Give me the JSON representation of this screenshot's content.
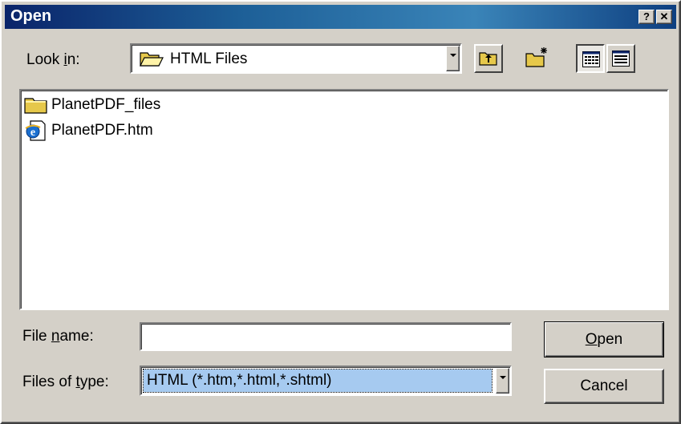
{
  "window": {
    "title": "Open",
    "help_glyph": "?",
    "close_glyph": "✕"
  },
  "look_in": {
    "label_pre": "Look ",
    "label_accel": "i",
    "label_post": "n:",
    "value": "HTML Files",
    "icon": "open-folder-icon"
  },
  "toolbar": {
    "buttons": [
      {
        "name": "up-one-level",
        "icon": "up-folder-icon"
      },
      {
        "name": "create-new-folder",
        "icon": "new-folder-icon"
      },
      {
        "name": "list-view",
        "icon": "list-view-icon",
        "pressed": true
      },
      {
        "name": "details-view",
        "icon": "details-view-icon",
        "pressed": false
      }
    ]
  },
  "files": [
    {
      "name": "PlanetPDF_files",
      "icon": "folder-icon"
    },
    {
      "name": "PlanetPDF.htm",
      "icon": "ie-document-icon"
    }
  ],
  "file_name": {
    "label_pre": "File ",
    "label_accel": "n",
    "label_post": "ame:",
    "value": ""
  },
  "file_type": {
    "label_pre": "Files of ",
    "label_accel": "t",
    "label_post": "ype:",
    "value": "HTML (*.htm,*.html,*.shtml)"
  },
  "buttons": {
    "open_accel": "O",
    "open_rest": "pen",
    "cancel": "Cancel"
  },
  "colors": {
    "face": "#d4d0c8",
    "title_bar": "#0a246a",
    "selection": "#a6caf0"
  }
}
